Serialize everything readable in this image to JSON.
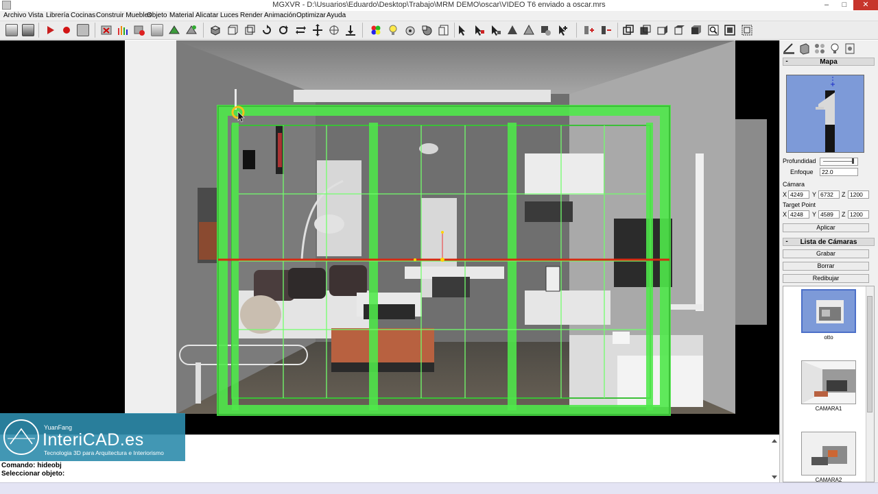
{
  "window": {
    "title": "MGXVR - D:\\Usuarios\\Eduardo\\Desktop\\Trabajo\\MRM DEMO\\oscar\\VIDEO T6 enviado a oscar.mrs",
    "minimize": "–",
    "maximize": "□",
    "close": "✕"
  },
  "menu": [
    "Archivo",
    "Vista",
    "Librería",
    "Cocinas",
    "Construir Muebles",
    "Objeto",
    "Material",
    "Alicatar",
    "Luces",
    "Render",
    "Animación",
    "Optimizar",
    "Ayuda"
  ],
  "toolbar_icons": [
    "new-icon",
    "save-icon",
    "play-icon",
    "record-icon",
    "camera-icon",
    "delete-icon",
    "bars-icon",
    "erase-icon",
    "wall-icon",
    "tile-icon",
    "paint-icon",
    "cube-icon",
    "box-icon",
    "frame-icon",
    "rotate-icon",
    "rotate-z-icon",
    "swap-icon",
    "move-icon",
    "scale-icon",
    "drop-icon",
    "color-icon",
    "light-icon",
    "bucket-icon",
    "render-icon",
    "page-icon",
    "pointer-icon",
    "select-icon",
    "select-add-icon",
    "sharp-icon",
    "cone-icon",
    "group-icon",
    "pointer-plus-icon",
    "snap-icon",
    "snap2-icon",
    "view-persp-icon",
    "view-front-icon",
    "view-side-icon",
    "view-top-icon",
    "view-iso-icon",
    "zoom-icon",
    "zoom-extents-icon",
    "zoom-window-icon"
  ],
  "panel": {
    "tabs": [
      "tools-tab",
      "materials-tab",
      "objects-tab",
      "lights-tab",
      "library-tab"
    ],
    "map_header": "Mapa",
    "profundidad_label": "Profundidad",
    "enfoque_label": "Enfoque",
    "enfoque_value": "22.0",
    "camara_label": "Cámara",
    "camara": {
      "x": "4249",
      "y": "6732",
      "z": "1200"
    },
    "target_label": "Target Point",
    "target": {
      "x": "4248",
      "y": "4589",
      "z": "1200"
    },
    "axis": {
      "x": "X",
      "y": "Y",
      "z": "Z"
    },
    "aplicar": "Aplicar",
    "list_header": "Lista de Cámaras",
    "grabar": "Grabar",
    "borrar": "Borrar",
    "redibujar": "Redibujar",
    "cameras": [
      "otto",
      "CAMARA1",
      "CAMARA2"
    ]
  },
  "command": {
    "line1": "Comando: hideobj",
    "line2": "Seleccionar objeto:"
  },
  "logo": {
    "small": "YuanFang",
    "brand": "InteriCAD.es",
    "tagline": "Tecnologia 3D para Arquitectura e Interiorismo"
  },
  "colors": {
    "selection": "#4fe84a",
    "axis_red": "#d62a10"
  }
}
